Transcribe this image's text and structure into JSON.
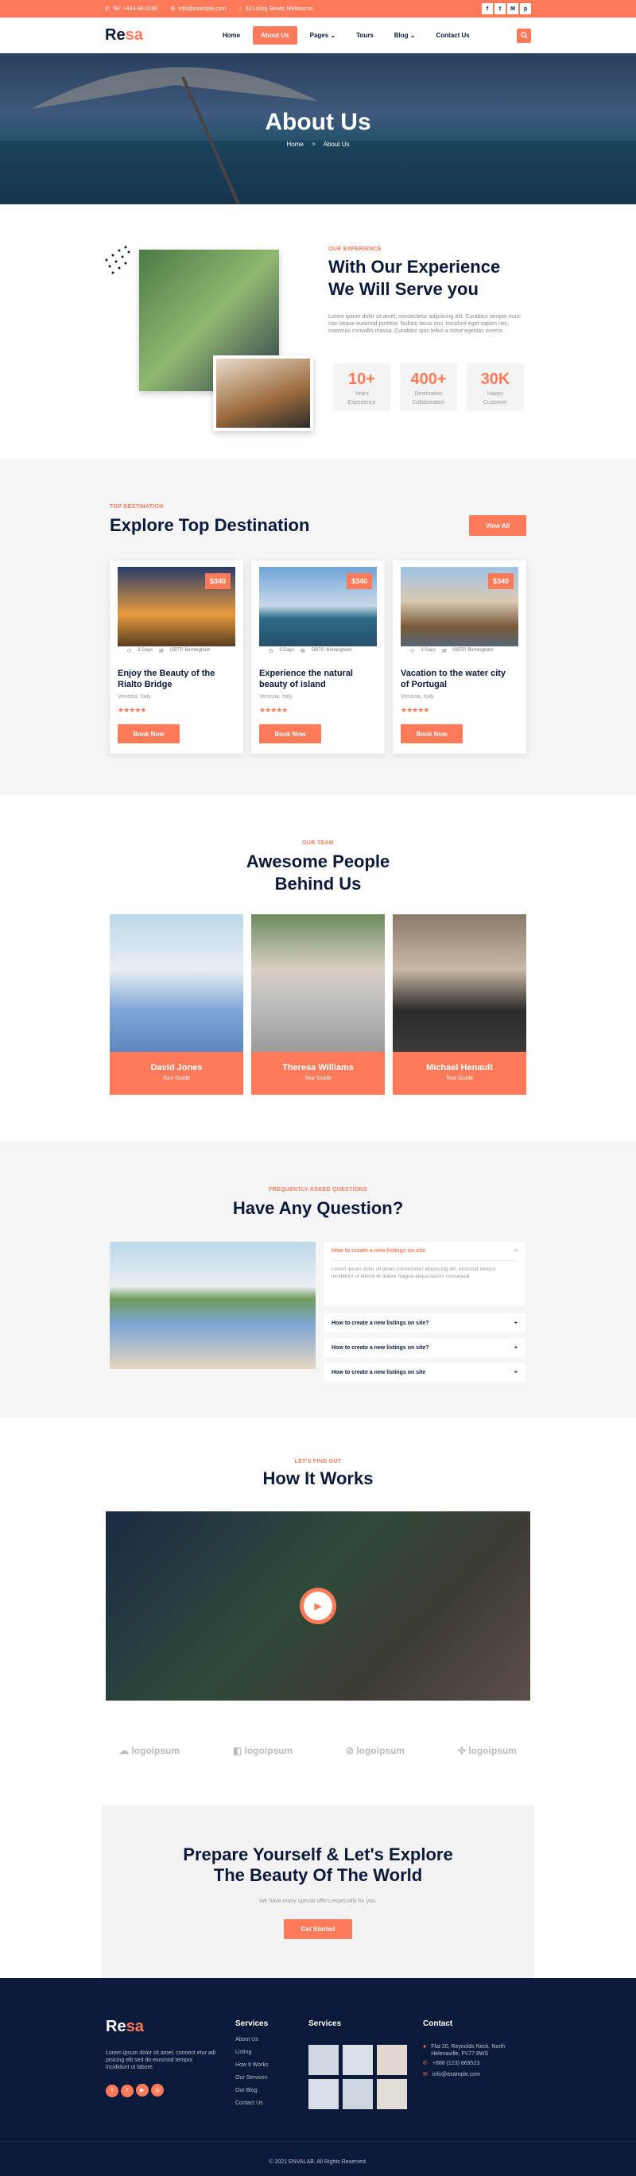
{
  "topbar": {
    "phone": "Tel: +443-98-0290",
    "email": "info@example.com",
    "address": "321 King Street, Melbourne",
    "social": [
      "f",
      "t",
      "✉",
      "p"
    ]
  },
  "nav": {
    "logo_a": "Re",
    "logo_b": "sa",
    "items": [
      "Home",
      "About Us",
      "Pages",
      "Tours",
      "Blog",
      "Contact Us"
    ],
    "active": "About Us"
  },
  "hero": {
    "title": "About Us",
    "crumb_home": "Home",
    "crumb_sep": ">",
    "crumb_current": "About Us"
  },
  "about": {
    "eyebrow": "OUR EXPERIENCE",
    "title1": "With Our Experience",
    "title2": "We Will Serve you",
    "body": "Lorem ipsum dolor sit amet, consectetur adipiscing elit. Curabitur tempor nunc non neque euismod porttitor. Nullam lacus orci, tincidunt eget sapien nec, maximus convallis massa. Curabitur quis tellus a tortor egestas viverra.",
    "stats": [
      {
        "n": "10+",
        "l1": "Years",
        "l2": "Experience"
      },
      {
        "n": "400+",
        "l1": "Destination",
        "l2": "Collaboration"
      },
      {
        "n": "30K",
        "l1": "Happy",
        "l2": "Customer"
      }
    ]
  },
  "dest": {
    "eyebrow": "TOP DESTINATION",
    "title": "Explore Top Destination",
    "view_all": "View All",
    "cards": [
      {
        "price": "$340",
        "days": "3 Days",
        "place": "GBTP, Birmingham",
        "title1": "Enjoy the Beauty of the",
        "title2": "Rialto Bridge",
        "loc": "Venezia, Italy",
        "stars": "★★★★★",
        "btn": "Book Now"
      },
      {
        "price": "$340",
        "days": "3 Days",
        "place": "GBTP, Birmingham",
        "title1": "Experience the natural",
        "title2": "beauty of island",
        "loc": "Venezia, Italy",
        "stars": "★★★★★",
        "btn": "Book Now"
      },
      {
        "price": "$340",
        "days": "3 Days",
        "place": "GBTP, Birmingham",
        "title1": "Vacation to the water city",
        "title2": "of Portugal",
        "loc": "Venezia, Italy",
        "stars": "★★★★★",
        "btn": "Book Now"
      }
    ]
  },
  "team": {
    "eyebrow": "OUR TEAM",
    "title1": "Awesome People",
    "title2": "Behind Us",
    "members": [
      {
        "name": "David Jones",
        "role": "Tour Guide"
      },
      {
        "name": "Theresa Williams",
        "role": "Tour Guide"
      },
      {
        "name": "Michael Henault",
        "role": "Tour Guide"
      }
    ]
  },
  "faq": {
    "eyebrow": "FREQUENTLY ASKED QUESTIONS",
    "title": "Have Any Question?",
    "open_q": "How to create a new listings on site",
    "open_a": "Lorem ipsum dolor sit amet, consectetur adipiscing elit, eiusmod tempor incididunt ut labore et dolore magna aliqua labors consequat.",
    "questions": [
      "How to create a new listings on site?",
      "How to create a new listings on site?",
      "How to create a new listings on site"
    ]
  },
  "how": {
    "eyebrow": "LET'S FIND OUT",
    "title": "How It Works",
    "logos": [
      "logoipsum",
      "logoipsum",
      "logoipsum",
      "logoipsum"
    ]
  },
  "cta": {
    "title1": "Prepare Yourself & Let's Explore",
    "title2": "The Beauty Of The World",
    "sub": "We have many special offers especially for you.",
    "btn": "Get Started"
  },
  "footer": {
    "about": "Lorem ipsum dolor sit amet, connect etur adi pisicing elit sed do eiusmod tempor incididunt ut labore.",
    "services_title": "Services",
    "links": [
      "About Us",
      "Listing",
      "How It Works",
      "Our Services",
      "Our Blog",
      "Contact Us"
    ],
    "gallery_title": "Services",
    "contact_title": "Contact",
    "address1": "Flat 20, Reynolds Neck, North",
    "address2": "Helenaville, FV77 8WS",
    "phone": "+888 (123) 869523",
    "email": "info@example.com",
    "copyright": "© 2021 ENVALAB. All Rights Reserved.",
    "social": [
      "f",
      "t",
      "▶",
      "◎"
    ]
  },
  "colors": {
    "accent": "#ff7a59",
    "navy": "#0b1a3a"
  }
}
